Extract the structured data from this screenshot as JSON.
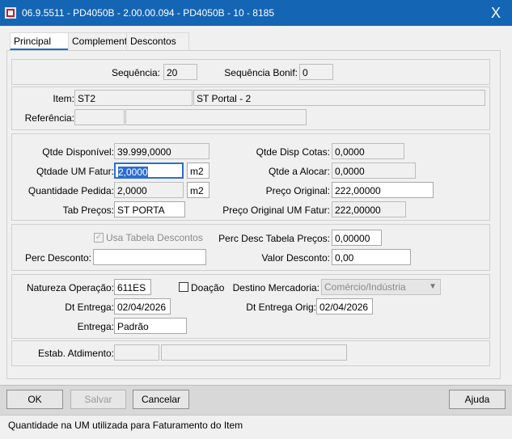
{
  "window": {
    "title": "06.9.5511 - PD4050B - 2.00.00.094 - PD4050B - 10 - 8185",
    "close_glyph": "X"
  },
  "tabs": [
    {
      "label": "Principal"
    },
    {
      "label": "Complementc"
    },
    {
      "label": "Descontos"
    }
  ],
  "seq": {
    "label": "Sequência:",
    "value": "20",
    "bonif_label": "Sequência Bonif:",
    "bonif_value": "0"
  },
  "item": {
    "label": "Item:",
    "code": "ST2",
    "desc": "ST Portal - 2",
    "ref_label": "Referência:",
    "ref_code": "",
    "ref_desc": ""
  },
  "qty": {
    "qtde_disp_label": "Qtde Disponível:",
    "qtde_disp": "39.999,0000",
    "qtde_disp_cotas_label": "Qtde Disp Cotas:",
    "qtde_disp_cotas": "0,0000",
    "qtde_um_fatur_label": "Qtdade UM Fatur:",
    "qtde_um_fatur": "2,0000",
    "um_fatur": "m2",
    "qtde_alocar_label": "Qtde a Alocar:",
    "qtde_alocar": "0,0000",
    "qtde_pedida_label": "Quantidade Pedida:",
    "qtde_pedida": "2,0000",
    "um_pedida": "m2",
    "preco_orig_label": "Preço Original:",
    "preco_orig": "222,00000",
    "tab_precos_label": "Tab Preços:",
    "tab_precos": "ST PORTA",
    "preco_orig_um_label": "Preço Original UM Fatur:",
    "preco_orig_um": "222,00000"
  },
  "desc": {
    "usa_tabela_label": "Usa Tabela Descontos",
    "perc_desc_tab_label": "Perc Desc Tabela Preços:",
    "perc_desc_tab": "0,00000",
    "perc_desc_label": "Perc Desconto:",
    "perc_desc": "",
    "valor_desc_label": "Valor Desconto:",
    "valor_desc": "0,00"
  },
  "oper": {
    "natureza_label": "Natureza Operação:",
    "natureza": "611ES",
    "doacao_label": "Doação",
    "destino_label": "Destino Mercadoria:",
    "destino": "Comércio/Indústria",
    "dt_entrega_label": "Dt Entrega:",
    "dt_entrega": "02/04/2026",
    "dt_entrega_orig_label": "Dt Entrega Orig:",
    "dt_entrega_orig": "02/04/2026",
    "entrega_label": "Entrega:",
    "entrega": "Padrão"
  },
  "estab": {
    "label": "Estab. Atdimento:",
    "code": "",
    "desc": ""
  },
  "buttons": {
    "ok": "OK",
    "salvar": "Salvar",
    "cancelar": "Cancelar",
    "ajuda": "Ajuda"
  },
  "status": "Quantidade na UM utilizada para Faturamento do Item",
  "colors": {
    "titlebar": "#1565b5",
    "focus": "#2c6dd0"
  },
  "icons": {
    "app": "app-icon",
    "close": "close-icon",
    "checkmark": "checkmark-icon",
    "dropdown": "chevron-down-icon"
  }
}
